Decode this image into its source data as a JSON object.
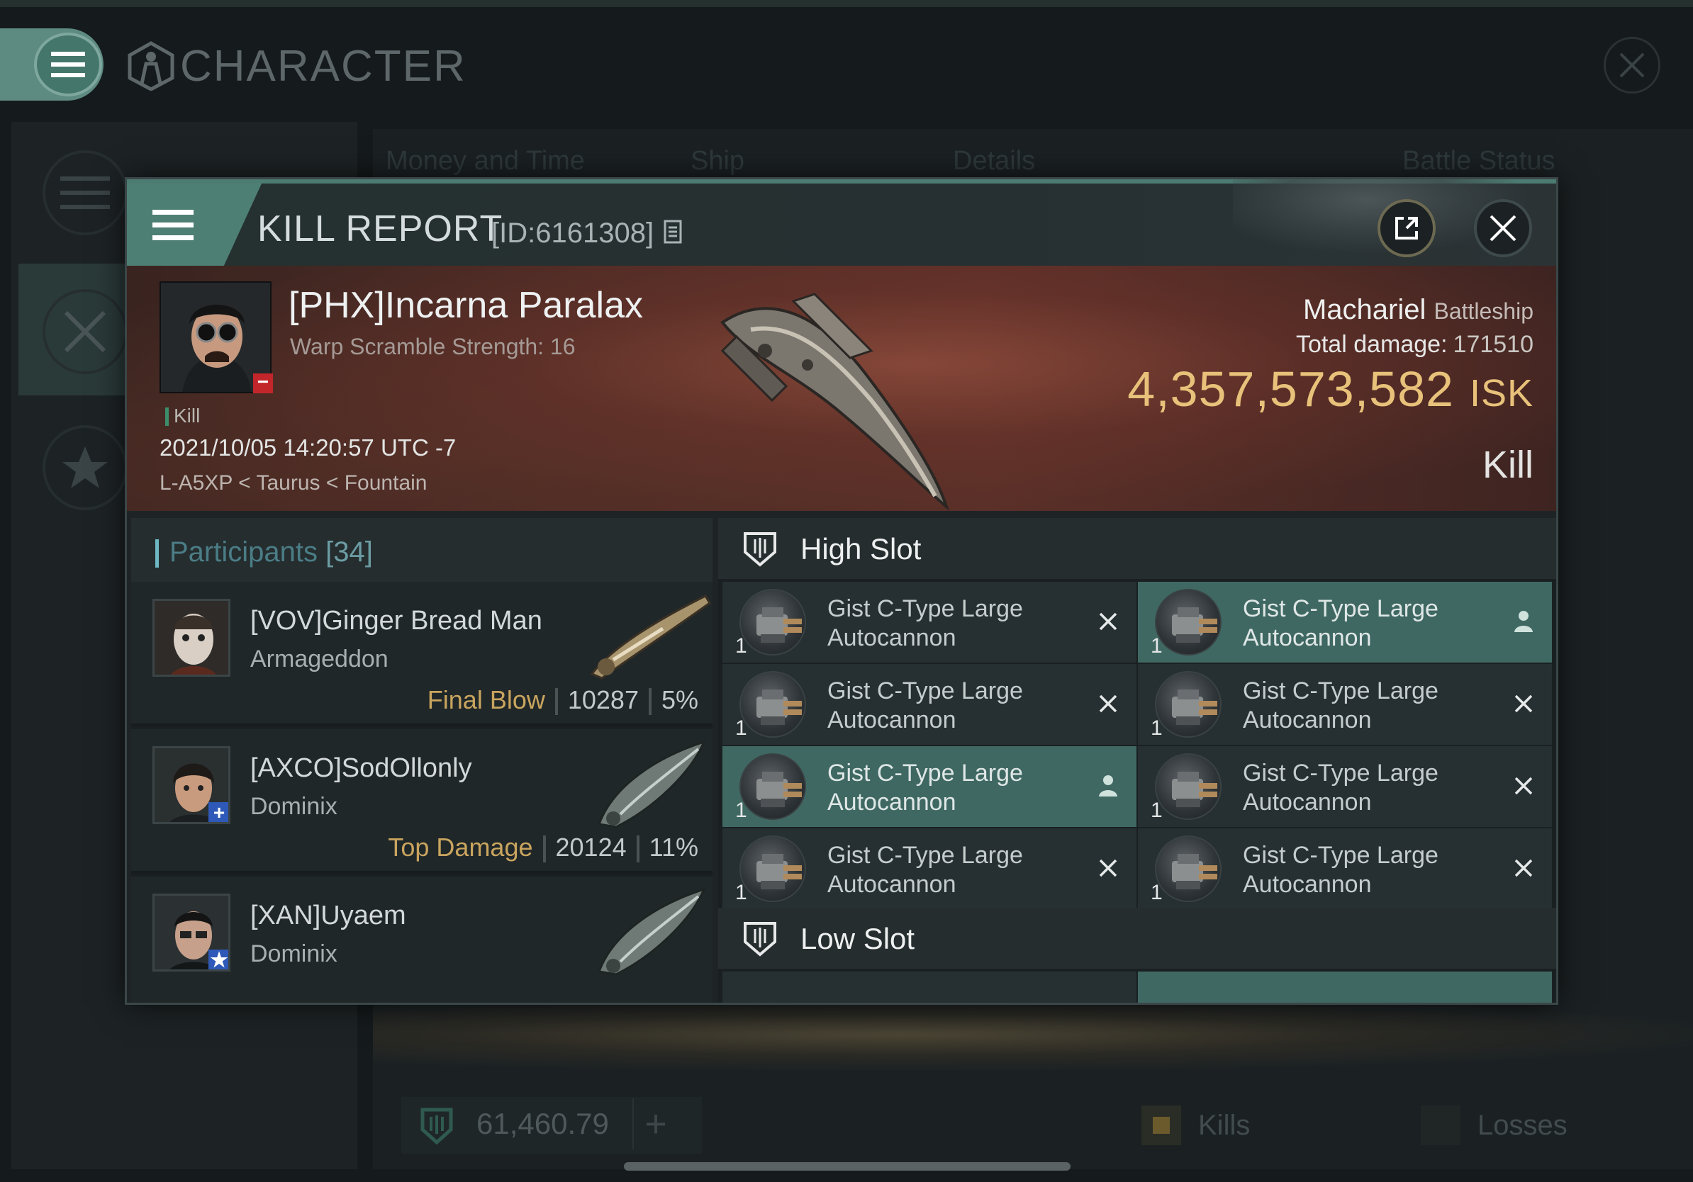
{
  "app": {
    "title": "CHARACTER",
    "tabs": [
      "Money and Time",
      "Ship",
      "Details",
      "Battle Status"
    ],
    "wallet": "61,460.79",
    "filters": {
      "kills": "Kills",
      "losses": "Losses"
    }
  },
  "report": {
    "title": "KILL REPORT",
    "id": "[ID:6161308]",
    "victim": {
      "name": "[PHX]Incarna Paralax",
      "warp": "Warp Scramble Strength: 16",
      "badge": "−"
    },
    "type_tag": "Kill",
    "timestamp": "2021/10/05 14:20:57 UTC -7",
    "location": "L-A5XP < Taurus < Fountain",
    "ship": {
      "name": "Machariel",
      "class": "Battleship"
    },
    "total_damage_label": "Total damage:",
    "total_damage": "171510",
    "value": "4,357,573,582",
    "value_unit": "ISK",
    "result": "Kill"
  },
  "participants": {
    "label": "Participants",
    "count": "[34]",
    "rows": [
      {
        "name": "[VOV]Ginger Bread Man",
        "ship": "Armageddon",
        "stat_label": "Final Blow",
        "damage": "10287",
        "percent": "5%",
        "badge": ""
      },
      {
        "name": "[AXCO]SodOllonly",
        "ship": "Dominix",
        "stat_label": "Top Damage",
        "damage": "20124",
        "percent": "11%",
        "badge": "+"
      },
      {
        "name": "[XAN]Uyaem",
        "ship": "Dominix",
        "stat_label": "",
        "damage": "",
        "percent": "",
        "badge": "★"
      }
    ]
  },
  "slots": {
    "high": {
      "title": "High Slot",
      "items": [
        {
          "name": "Gist C-Type Large Autocannon",
          "qty": "1",
          "state": "destroyed"
        },
        {
          "name": "Gist C-Type Large Autocannon",
          "qty": "1",
          "state": "dropped"
        },
        {
          "name": "Gist C-Type Large Autocannon",
          "qty": "1",
          "state": "destroyed"
        },
        {
          "name": "Gist C-Type Large Autocannon",
          "qty": "1",
          "state": "destroyed"
        },
        {
          "name": "Gist C-Type Large Autocannon",
          "qty": "1",
          "state": "dropped"
        },
        {
          "name": "Gist C-Type Large Autocannon",
          "qty": "1",
          "state": "destroyed"
        },
        {
          "name": "Gist C-Type Large Autocannon",
          "qty": "1",
          "state": "destroyed"
        },
        {
          "name": "Gist C-Type Large Autocannon",
          "qty": "1",
          "state": "destroyed"
        }
      ]
    },
    "low": {
      "title": "Low Slot"
    }
  },
  "colors": {
    "accent": "#4e7f74",
    "isk": "#e8c27a",
    "final_blow": "#c9a55e",
    "dropped": "#3f6863"
  },
  "icons": [
    "menu-icon",
    "character-icon",
    "close-icon",
    "share-icon",
    "copy-icon",
    "shield-slot-icon",
    "pilot-icon",
    "x-icon",
    "wallet-icon",
    "plus-icon",
    "star-icon",
    "swords-icon"
  ]
}
